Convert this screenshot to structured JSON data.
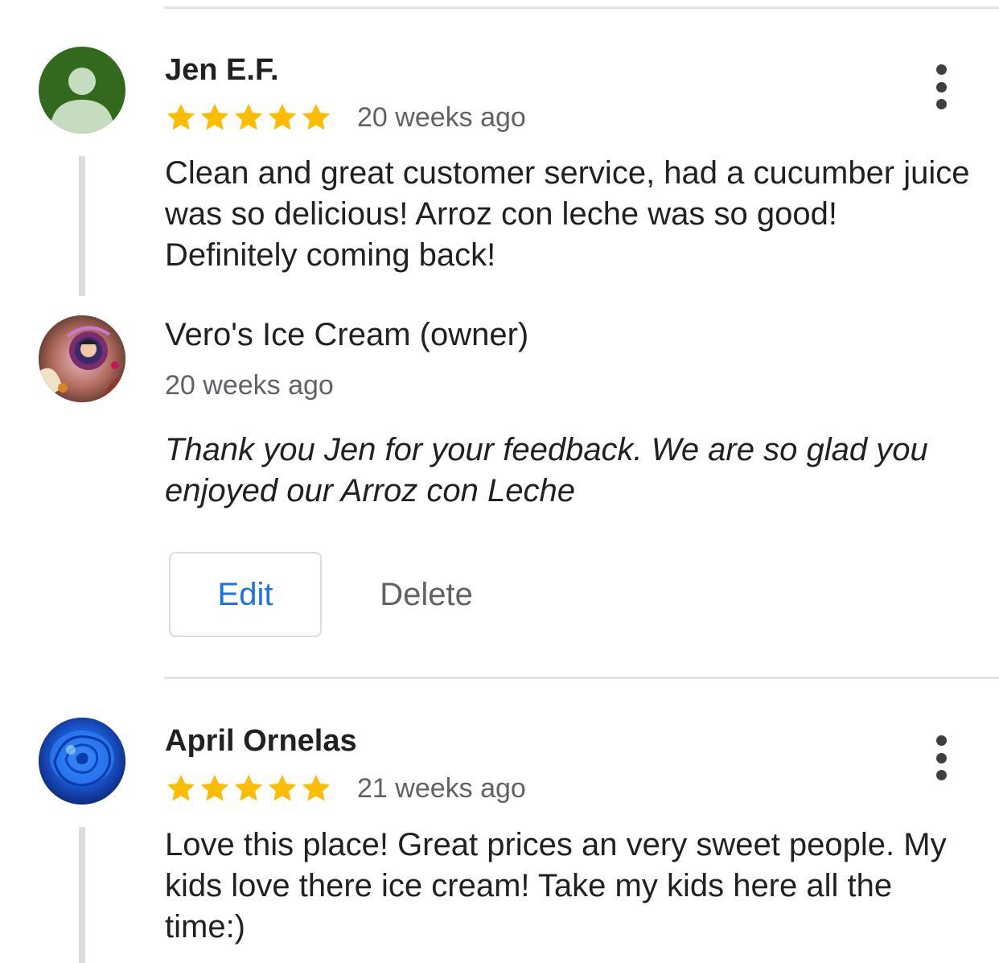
{
  "reviews": [
    {
      "author": "Jen E.F.",
      "avatar_icon": "person-icon",
      "avatar_color": "#33691e",
      "stars": 5,
      "time": "20 weeks ago",
      "text": "Clean and great customer service, had a cucumber juice was so delicious! Arroz con leche was so good! Definitely coming back!",
      "owner_reply": {
        "author": "Vero's Ice Cream (owner)",
        "time": "20 weeks ago",
        "text": "Thank you Jen for your feedback. We are so glad you enjoyed our Arroz con Leche",
        "actions": {
          "edit_label": "Edit",
          "delete_label": "Delete"
        }
      }
    },
    {
      "author": "April Ornelas",
      "avatar_icon": "blue-rose-photo",
      "stars": 5,
      "time": "21 weeks ago",
      "text": "Love this place! Great prices an very sweet people. My kids love there ice cream! Take my kids here all the time:)"
    }
  ],
  "colors": {
    "star": "#fbbc04",
    "link": "#1a73e8",
    "secondary_text": "#5f6368"
  },
  "icons": {
    "more": "more-vert-icon",
    "star": "star-icon"
  }
}
